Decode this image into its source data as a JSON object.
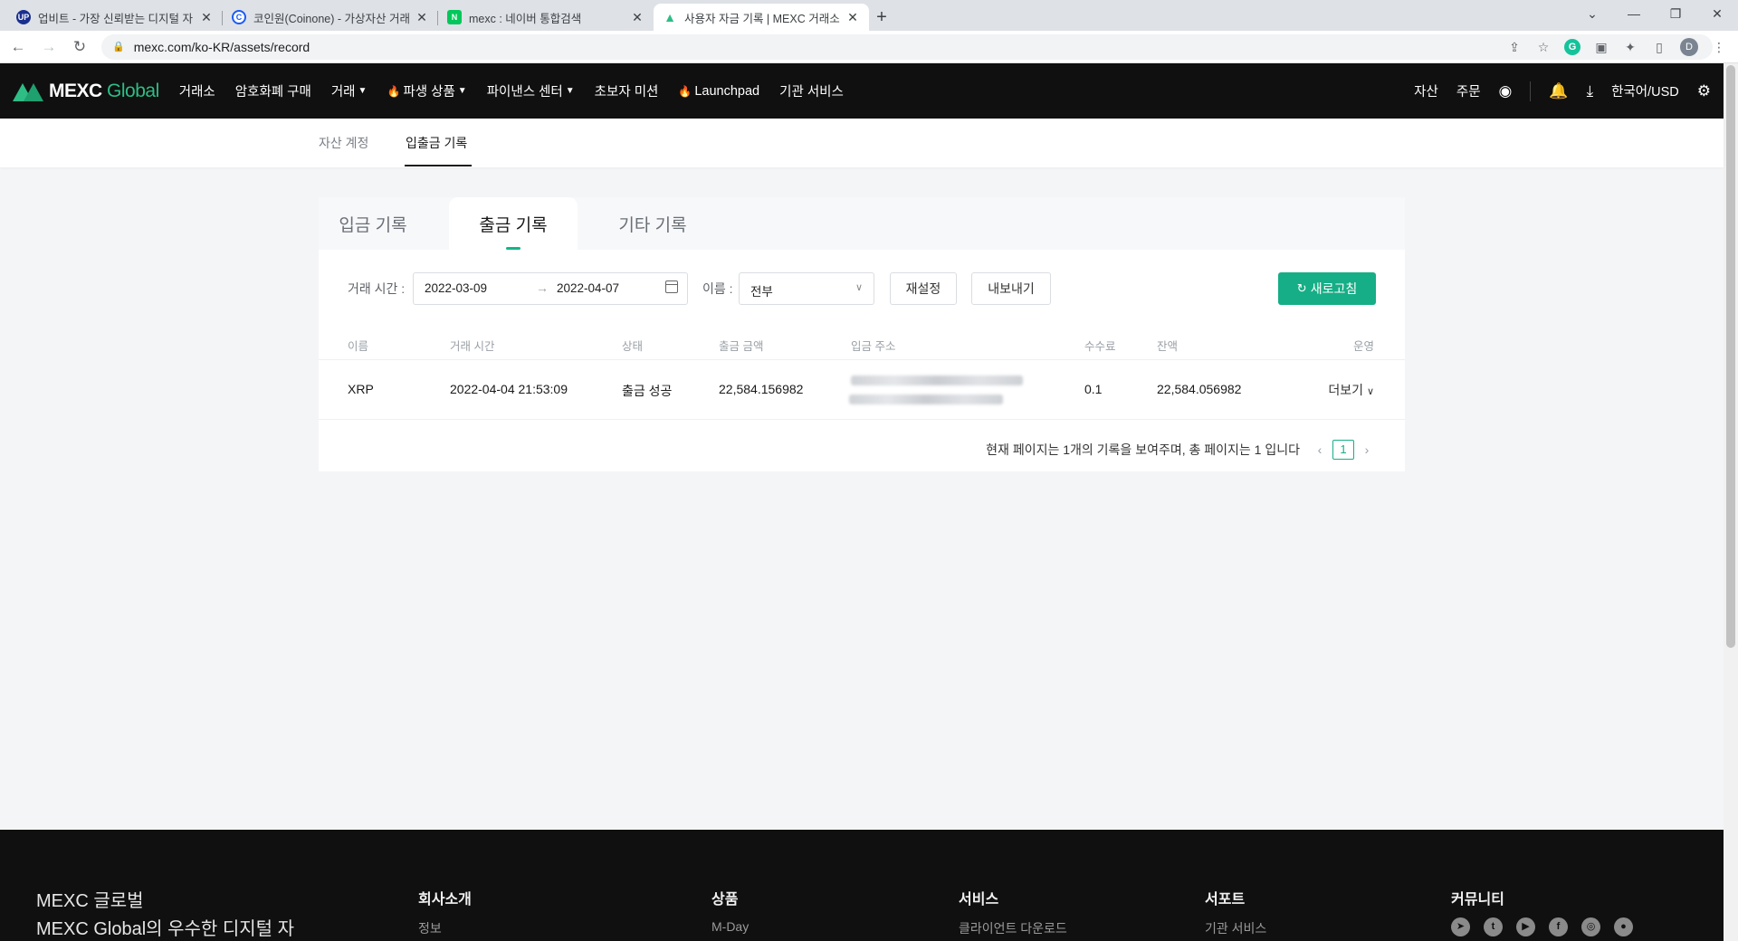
{
  "browser": {
    "tabs": [
      {
        "title": "업비트 - 가장 신뢰받는 디지털 자",
        "icon": "upbit-favicon",
        "active": false
      },
      {
        "title": "코인원(Coinone) - 가상자산 거래",
        "icon": "coinone-favicon",
        "active": false
      },
      {
        "title": "mexc : 네이버 통합검색",
        "icon": "naver-favicon",
        "active": false
      },
      {
        "title": "사용자 자금 기록 | MEXC 거래소",
        "icon": "mexc-favicon",
        "active": true
      }
    ],
    "url": "mexc.com/ko-KR/assets/record",
    "profile_initial": "D"
  },
  "header": {
    "logo_main": "MEXC",
    "logo_sub": "Global",
    "nav": [
      "거래소",
      "암호화폐 구매",
      "거래",
      "파생 상품",
      "파이낸스 센터",
      "초보자 미션",
      "Launchpad",
      "기관 서비스"
    ],
    "right": {
      "assets": "자산",
      "orders": "주문",
      "language": "한국어/USD"
    }
  },
  "subnav": {
    "account": "자산 계정",
    "records": "입출금 기록"
  },
  "record_tabs": {
    "deposit": "입금 기록",
    "withdraw": "출금 기록",
    "other": "기타 기록"
  },
  "filters": {
    "time_label": "거래 시간 :",
    "date_from": "2022-03-09",
    "date_to": "2022-04-07",
    "name_label": "이름 :",
    "name_value": "전부",
    "reset": "재설정",
    "export": "내보내기",
    "refresh": "새로고침"
  },
  "table": {
    "headers": {
      "name": "이름",
      "time": "거래 시간",
      "status": "상태",
      "amount": "출금 금액",
      "address": "입금 주소",
      "fee": "수수료",
      "balance": "잔액",
      "action": "운영"
    },
    "rows": [
      {
        "name": "XRP",
        "time": "2022-04-04 21:53:09",
        "status": "출금 성공",
        "amount": "22,584.156982",
        "fee": "0.1",
        "balance": "22,584.056982",
        "action": "더보기"
      }
    ]
  },
  "pagination": {
    "summary": "현재 페이지는 1개의 기록을 보여주며, 총 페이지는 1 입니다",
    "current": "1"
  },
  "footer": {
    "brand_title": "MEXC 글로벌",
    "brand_desc": "MEXC Global의 우수한 디지털 자",
    "columns": [
      {
        "heading": "회사소개",
        "link": "정보"
      },
      {
        "heading": "상품",
        "link": "M-Day"
      },
      {
        "heading": "서비스",
        "link": "클라이언트 다운로드"
      },
      {
        "heading": "서포트",
        "link": "기관 서비스"
      },
      {
        "heading": "커뮤니티",
        "link": ""
      }
    ],
    "social_icons": [
      "telegram-icon",
      "twitter-icon",
      "youtube-icon",
      "facebook-icon",
      "discord-icon",
      "reddit-icon"
    ]
  },
  "colors": {
    "accent": "#16ae86",
    "header_bg": "#101010",
    "page_bg": "#f4f5f7"
  }
}
